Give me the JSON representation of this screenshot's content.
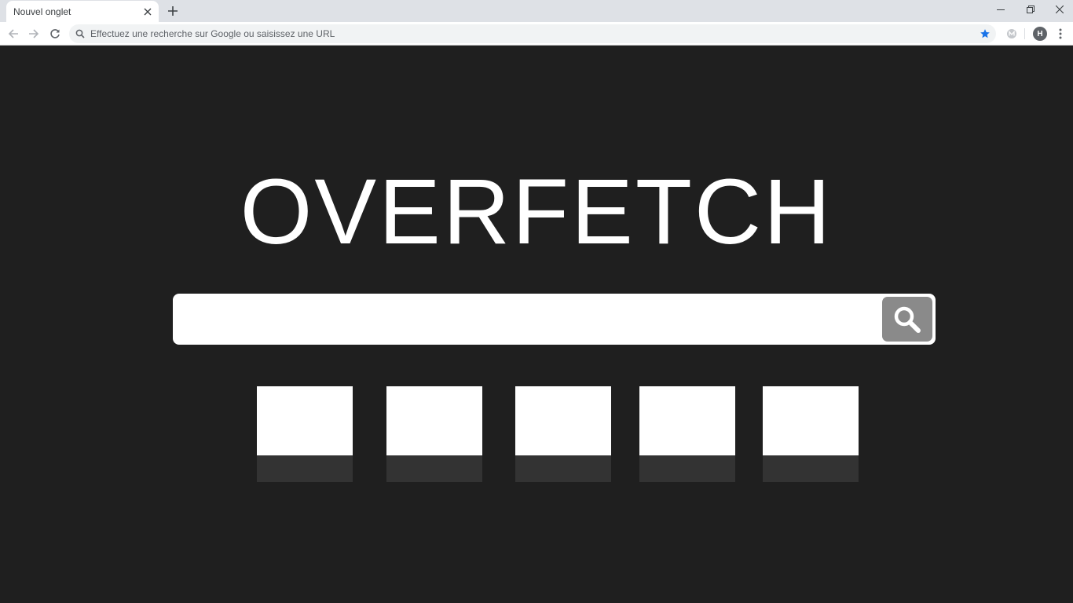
{
  "browser": {
    "tab_title": "Nouvel onglet",
    "omnibox_placeholder": "Effectuez une recherche sur Google ou saisissez une URL",
    "profile_initial": "H",
    "accent_color": "#1a73e8"
  },
  "page": {
    "logo_text": "OVERFETCH",
    "background_color": "#1f1f1f",
    "search": {
      "value": "",
      "button_icon": "search-icon"
    },
    "shortcuts": [
      {
        "label": ""
      },
      {
        "label": ""
      },
      {
        "label": ""
      },
      {
        "label": ""
      },
      {
        "label": ""
      }
    ]
  }
}
